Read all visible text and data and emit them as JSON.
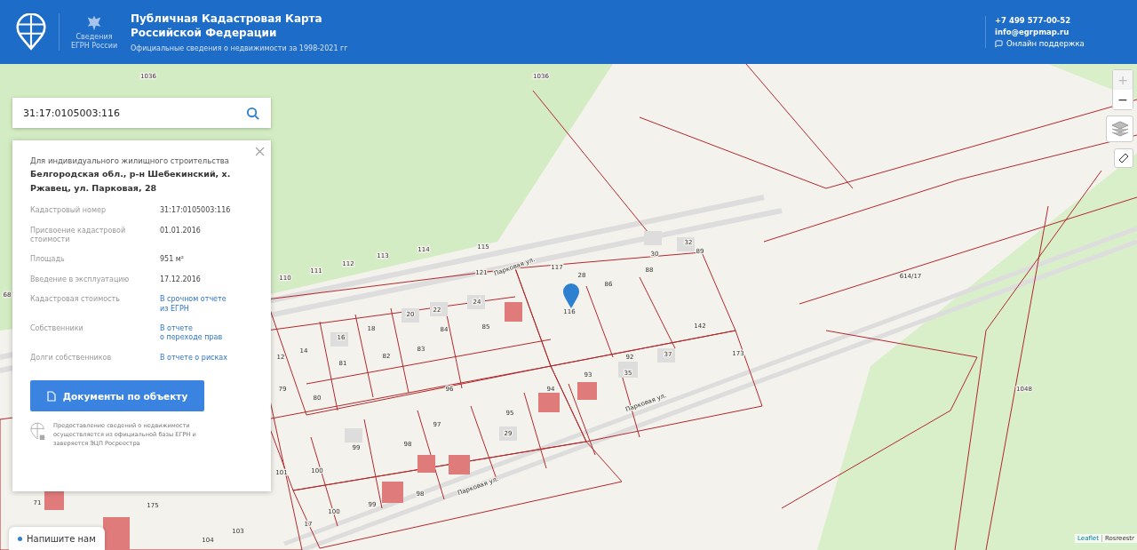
{
  "header": {
    "emblem_caption": "Сведения ЕГРН России",
    "title": "Публичная Кадастровая Карта Российской Федерации",
    "subtitle": "Официальные сведения о недвижимости за 1998-2021 гг",
    "phone": "+7 499 577-00-52",
    "email": "info@egrpmap.ru",
    "support": "Онлайн поддержка"
  },
  "search": {
    "value": "31:17:0105003:116"
  },
  "card": {
    "purpose": "Для индивидуального жилищного строительства",
    "address": "Белгородская обл., р-н Шебекинский, х. Ржавец, ул. Парковая, 28",
    "rows": [
      {
        "label": "Кадастровый номер",
        "value": "31:17:0105003:116",
        "kind": "text"
      },
      {
        "label": "Присвоение кадастровой стоимости",
        "value": "01.01.2016",
        "kind": "text"
      },
      {
        "label": "Площадь",
        "value": "951 м²",
        "kind": "text"
      },
      {
        "label": "Введение в эксплуатацию",
        "value": "17.12.2016",
        "kind": "text"
      },
      {
        "label": "Кадастровая стоимость",
        "value": "В срочном отчете\nиз ЕГРН",
        "kind": "link"
      },
      {
        "label": "Собственники",
        "value": "В отчете\nо переходе прав",
        "kind": "link"
      },
      {
        "label": "Долги собственников",
        "value": "В отчете о рисках",
        "kind": "link"
      }
    ],
    "button": "Документы по объекту",
    "note": "Предоставление сведений о недвижимости осуществляется из официальной базы ЕГРН и заверяется ЭЦП Росреестра"
  },
  "map_labels": [
    {
      "text": "1036",
      "kind": "parcel"
    },
    {
      "text": "1036",
      "kind": "parcel"
    },
    {
      "text": "1048",
      "kind": "parcel"
    },
    {
      "text": "614/17",
      "kind": "parcel"
    },
    {
      "text": "142",
      "kind": "parcel"
    },
    {
      "text": "116",
      "kind": "parcel"
    },
    {
      "text": "117",
      "kind": "parcel"
    },
    {
      "text": "86",
      "kind": "parcel"
    },
    {
      "text": "88",
      "kind": "parcel"
    },
    {
      "text": "30",
      "kind": "parcel"
    },
    {
      "text": "32",
      "kind": "parcel"
    },
    {
      "text": "89",
      "kind": "parcel"
    },
    {
      "text": "28",
      "kind": "parcel"
    },
    {
      "text": "115",
      "kind": "parcel"
    },
    {
      "text": "114",
      "kind": "parcel"
    },
    {
      "text": "113",
      "kind": "parcel"
    },
    {
      "text": "112",
      "kind": "parcel"
    },
    {
      "text": "111",
      "kind": "parcel"
    },
    {
      "text": "110",
      "kind": "parcel"
    },
    {
      "text": "121",
      "kind": "parcel"
    },
    {
      "text": "24",
      "kind": "parcel"
    },
    {
      "text": "22",
      "kind": "parcel"
    },
    {
      "text": "20",
      "kind": "parcel"
    },
    {
      "text": "85",
      "kind": "parcel"
    },
    {
      "text": "84",
      "kind": "parcel"
    },
    {
      "text": "83",
      "kind": "parcel"
    },
    {
      "text": "82",
      "kind": "parcel"
    },
    {
      "text": "81",
      "kind": "parcel"
    },
    {
      "text": "18",
      "kind": "parcel"
    },
    {
      "text": "16",
      "kind": "parcel"
    },
    {
      "text": "14",
      "kind": "parcel"
    },
    {
      "text": "12",
      "kind": "parcel"
    },
    {
      "text": "79",
      "kind": "parcel"
    },
    {
      "text": "80",
      "kind": "parcel"
    },
    {
      "text": "92",
      "kind": "parcel"
    },
    {
      "text": "35",
      "kind": "parcel"
    },
    {
      "text": "37",
      "kind": "parcel"
    },
    {
      "text": "93",
      "kind": "parcel"
    },
    {
      "text": "94",
      "kind": "parcel"
    },
    {
      "text": "95",
      "kind": "parcel"
    },
    {
      "text": "29",
      "kind": "parcel"
    },
    {
      "text": "97",
      "kind": "parcel"
    },
    {
      "text": "98",
      "kind": "parcel"
    },
    {
      "text": "99",
      "kind": "parcel"
    },
    {
      "text": "100",
      "kind": "parcel"
    },
    {
      "text": "101",
      "kind": "parcel"
    },
    {
      "text": "175",
      "kind": "parcel"
    },
    {
      "text": "104",
      "kind": "parcel"
    },
    {
      "text": "103",
      "kind": "parcel"
    },
    {
      "text": "17",
      "kind": "parcel"
    },
    {
      "text": "100",
      "kind": "parcel"
    },
    {
      "text": "99",
      "kind": "parcel"
    },
    {
      "text": "98",
      "kind": "parcel"
    },
    {
      "text": "71",
      "kind": "parcel"
    },
    {
      "text": "68",
      "kind": "parcel"
    },
    {
      "text": "173",
      "kind": "parcel"
    },
    {
      "text": "96",
      "kind": "parcel"
    },
    {
      "text": "Парковая ул.",
      "kind": "street"
    },
    {
      "text": "Парковая ул.",
      "kind": "street"
    },
    {
      "text": "Парковая ул.",
      "kind": "street"
    }
  ],
  "zoom": [
    {
      "label": "+",
      "disabled": true
    },
    {
      "label": "−",
      "disabled": false
    }
  ],
  "chat": {
    "label": "Напишите нам",
    "online": true
  },
  "attribution": [
    "Leaflet",
    "Rosreestr"
  ]
}
